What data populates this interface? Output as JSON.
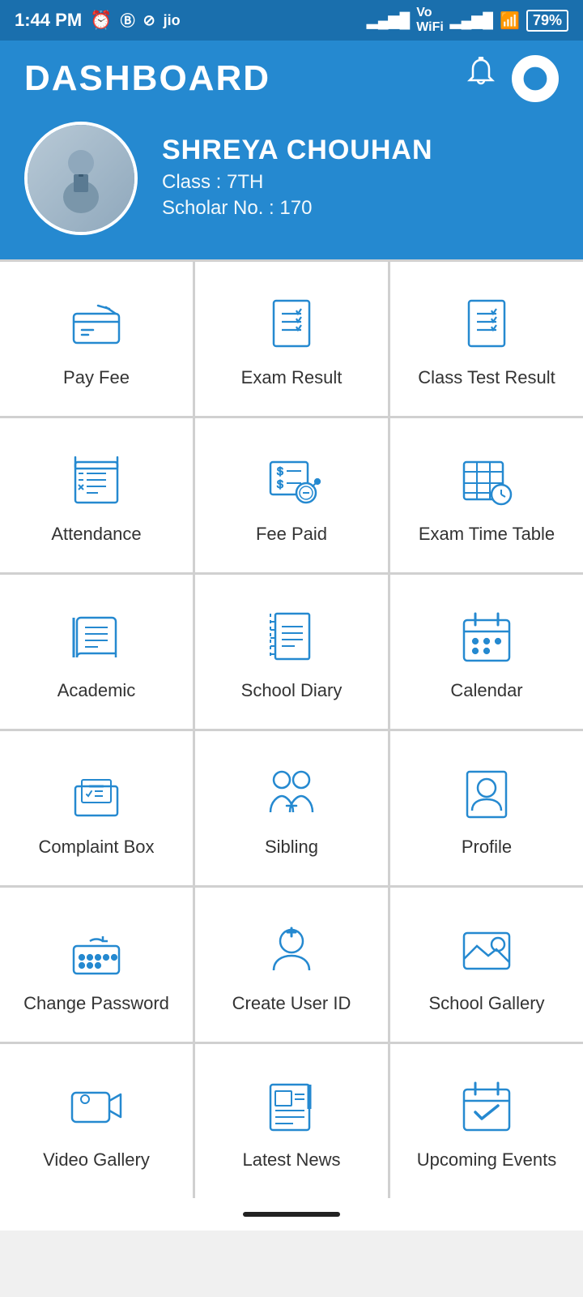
{
  "statusBar": {
    "time": "1:44 PM",
    "battery": "79"
  },
  "header": {
    "title": "DASHBOARD",
    "bellLabel": "Notifications",
    "powerLabel": "Logout"
  },
  "profile": {
    "name": "SHREYA  CHOUHAN",
    "class": "Class : 7TH",
    "scholar": "Scholar No. : 170"
  },
  "grid": {
    "items": [
      {
        "id": "pay-fee",
        "label": "Pay Fee",
        "icon": "payment"
      },
      {
        "id": "exam-result",
        "label": "Exam Result",
        "icon": "list-check"
      },
      {
        "id": "class-test-result",
        "label": "Class Test Result",
        "icon": "list-check2"
      },
      {
        "id": "attendance",
        "label": "Attendance",
        "icon": "attendance"
      },
      {
        "id": "fee-paid",
        "label": "Fee Paid",
        "icon": "fee-paid"
      },
      {
        "id": "exam-timetable",
        "label": "Exam Time Table",
        "icon": "timetable"
      },
      {
        "id": "academic",
        "label": "Academic",
        "icon": "book"
      },
      {
        "id": "school-diary",
        "label": "School Diary",
        "icon": "diary"
      },
      {
        "id": "calendar",
        "label": "Calendar",
        "icon": "calendar"
      },
      {
        "id": "complaint-box",
        "label": "Complaint Box",
        "icon": "complaint"
      },
      {
        "id": "sibling",
        "label": "Sibling",
        "icon": "sibling"
      },
      {
        "id": "profile",
        "label": "Profile",
        "icon": "profile"
      },
      {
        "id": "change-password",
        "label": "Change Password",
        "icon": "password"
      },
      {
        "id": "create-user-id",
        "label": "Create User ID",
        "icon": "create-user"
      },
      {
        "id": "school-gallery",
        "label": "School Gallery",
        "icon": "gallery"
      },
      {
        "id": "video-gallery",
        "label": "Video Gallery",
        "icon": "video"
      },
      {
        "id": "latest-news",
        "label": "Latest News",
        "icon": "news"
      },
      {
        "id": "upcoming-events",
        "label": "Upcoming Events",
        "icon": "events"
      }
    ]
  }
}
